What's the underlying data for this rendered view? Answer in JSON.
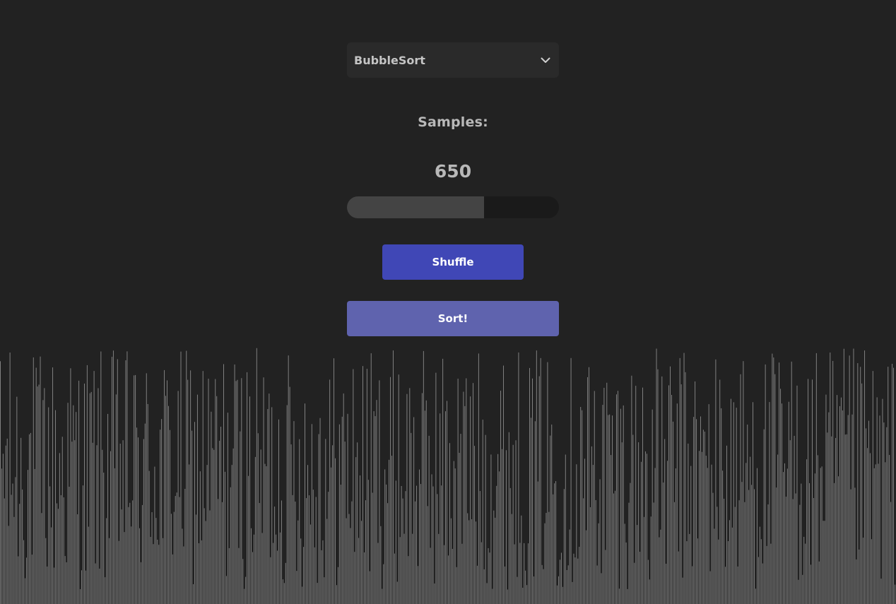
{
  "algorithm_select": {
    "selected": "BubbleSort",
    "icon": "chevron-down-icon"
  },
  "samples": {
    "label": "Samples:",
    "value": "650",
    "count": 650,
    "slider_fraction": 0.647
  },
  "buttons": {
    "shuffle_label": "Shuffle",
    "sort_label": "Sort!"
  },
  "colors": {
    "background": "#222222",
    "shuffle_button": "#4047b6",
    "sort_button": "#5f63ae",
    "bar": "#8a8a8a"
  }
}
